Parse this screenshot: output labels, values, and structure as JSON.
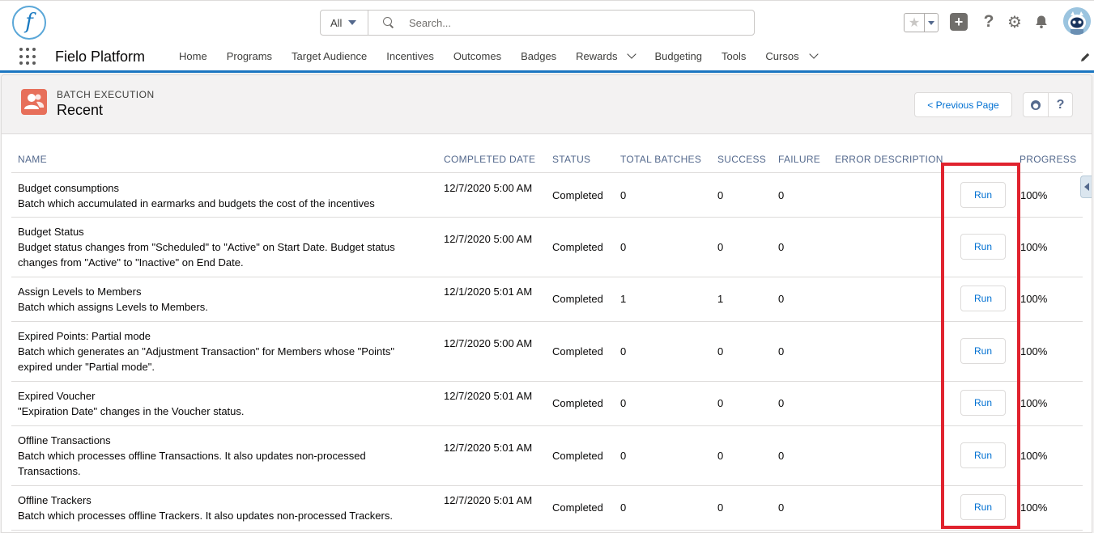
{
  "header": {
    "logo_letter": "f",
    "search_scope": "All",
    "search_placeholder": "Search..."
  },
  "nav": {
    "app_name": "Fielo Platform",
    "items": [
      {
        "label": "Home",
        "has_menu": false
      },
      {
        "label": "Programs",
        "has_menu": false
      },
      {
        "label": "Target Audience",
        "has_menu": false
      },
      {
        "label": "Incentives",
        "has_menu": false
      },
      {
        "label": "Outcomes",
        "has_menu": false
      },
      {
        "label": "Badges",
        "has_menu": false
      },
      {
        "label": "Rewards",
        "has_menu": true
      },
      {
        "label": "Budgeting",
        "has_menu": false
      },
      {
        "label": "Tools",
        "has_menu": false
      },
      {
        "label": "Cursos",
        "has_menu": true
      }
    ]
  },
  "page": {
    "object_label": "BATCH EXECUTION",
    "title": "Recent",
    "prev_button": "< Previous Page"
  },
  "table": {
    "columns": {
      "name": "NAME",
      "completed_date": "COMPLETED DATE",
      "status": "STATUS",
      "total_batches": "TOTAL BATCHES",
      "success": "SUCCESS",
      "failure": "FAILURE",
      "error_description": "ERROR DESCRIPTION",
      "progress": "PROGRESS"
    },
    "rows": [
      {
        "name": "Budget consumptions",
        "desc": "Batch which accumulated in earmarks and budgets the cost of the incentives",
        "date": "12/7/2020 5:00 AM",
        "status": "Completed",
        "total": "0",
        "success": "0",
        "failure": "0",
        "action": "Run",
        "progress": "100%"
      },
      {
        "name": "Budget Status",
        "desc": "Budget status changes from \"Scheduled\" to \"Active\" on Start Date. Budget status changes from \"Active\" to \"Inactive\" on End Date.",
        "date": "12/7/2020 5:00 AM",
        "status": "Completed",
        "total": "0",
        "success": "0",
        "failure": "0",
        "action": "Run",
        "progress": "100%"
      },
      {
        "name": "Assign Levels to Members",
        "desc": "Batch which assigns Levels to Members.",
        "date": "12/1/2020 5:01 AM",
        "status": "Completed",
        "total": "1",
        "success": "1",
        "failure": "0",
        "action": "Run",
        "progress": "100%"
      },
      {
        "name": "Expired Points: Partial mode",
        "desc": "Batch which generates an \"Adjustment Transaction\" for Members whose \"Points\" expired under \"Partial mode\".",
        "date": "12/7/2020 5:00 AM",
        "status": "Completed",
        "total": "0",
        "success": "0",
        "failure": "0",
        "action": "Run",
        "progress": "100%"
      },
      {
        "name": "Expired Voucher",
        "desc": "\"Expiration Date\" changes in the Voucher status.",
        "date": "12/7/2020 5:01 AM",
        "status": "Completed",
        "total": "0",
        "success": "0",
        "failure": "0",
        "action": "Run",
        "progress": "100%"
      },
      {
        "name": "Offline Transactions",
        "desc": "Batch which processes offline Transactions. It also updates non-processed Transactions.",
        "date": "12/7/2020 5:01 AM",
        "status": "Completed",
        "total": "0",
        "success": "0",
        "failure": "0",
        "action": "Run",
        "progress": "100%"
      },
      {
        "name": "Offline Trackers",
        "desc": "Batch which processes offline Trackers. It also updates non-processed Trackers.",
        "date": "12/7/2020 5:01 AM",
        "status": "Completed",
        "total": "0",
        "success": "0",
        "failure": "0",
        "action": "Run",
        "progress": "100%"
      }
    ]
  },
  "colors": {
    "brand_blue": "#1b76c1",
    "link_blue": "#0070d2",
    "highlight_red": "#e0232e",
    "object_icon": "#e76f5a"
  },
  "icons": {
    "app_launcher": "waffle-icon",
    "favorite": "star-icon",
    "add": "plus-icon",
    "help": "question-icon",
    "setup": "gear-icon",
    "notifications": "bell-icon",
    "edit_nav": "pencil-icon",
    "object": "users-icon",
    "settings_btn": "head-icon"
  }
}
